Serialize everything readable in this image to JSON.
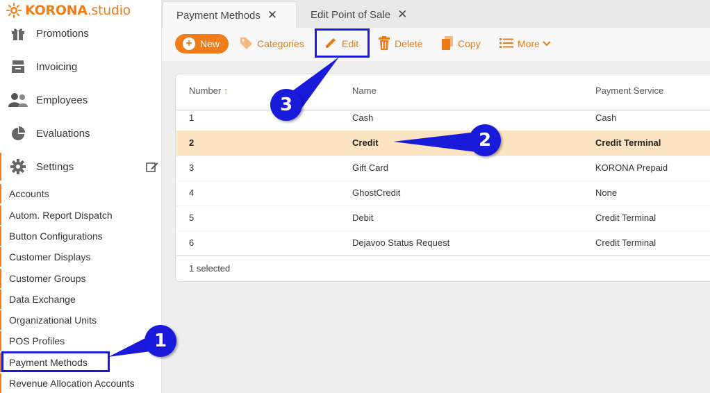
{
  "brand": {
    "name_bold": "KORONA",
    "name_suffix": ".studio"
  },
  "sidebar": {
    "nav": [
      {
        "label": "Promotions",
        "icon": "gift-icon"
      },
      {
        "label": "Invoicing",
        "icon": "cash-register-icon"
      },
      {
        "label": "Employees",
        "icon": "people-icon"
      },
      {
        "label": "Evaluations",
        "icon": "pie-chart-icon"
      },
      {
        "label": "Settings",
        "icon": "gear-icon"
      }
    ],
    "settings_items": [
      "Accounts",
      "Autom. Report Dispatch",
      "Button Configurations",
      "Customer Displays",
      "Customer Groups",
      "Data Exchange",
      "Organizational Units",
      "POS Profiles",
      "Payment Methods",
      "Revenue Allocation Accounts"
    ]
  },
  "tabs": [
    {
      "label": "Payment Methods",
      "active": true
    },
    {
      "label": "Edit Point of Sale",
      "active": false
    }
  ],
  "toolbar": {
    "new": "New",
    "categories": "Categories",
    "edit": "Edit",
    "delete": "Delete",
    "copy": "Copy",
    "more": "More"
  },
  "table": {
    "columns": [
      "Number",
      "Name",
      "Payment Service"
    ],
    "rows": [
      {
        "number": "1",
        "name": "Cash",
        "service": "Cash",
        "selected": false
      },
      {
        "number": "2",
        "name": "Credit",
        "service": "Credit Terminal",
        "selected": true
      },
      {
        "number": "3",
        "name": "Gift Card",
        "service": "KORONA Prepaid",
        "selected": false
      },
      {
        "number": "4",
        "name": "GhostCredit",
        "service": "None",
        "selected": false
      },
      {
        "number": "5",
        "name": "Debit",
        "service": "Credit Terminal",
        "selected": false
      },
      {
        "number": "6",
        "name": "Dejavoo Status Request",
        "service": "Credit Terminal",
        "selected": false
      }
    ],
    "footer": "1 selected"
  },
  "callouts": [
    "1",
    "2",
    "3"
  ],
  "colors": {
    "accent": "#f07c1a",
    "annotation": "#1a1adb",
    "selected_row": "#fce3c1"
  }
}
